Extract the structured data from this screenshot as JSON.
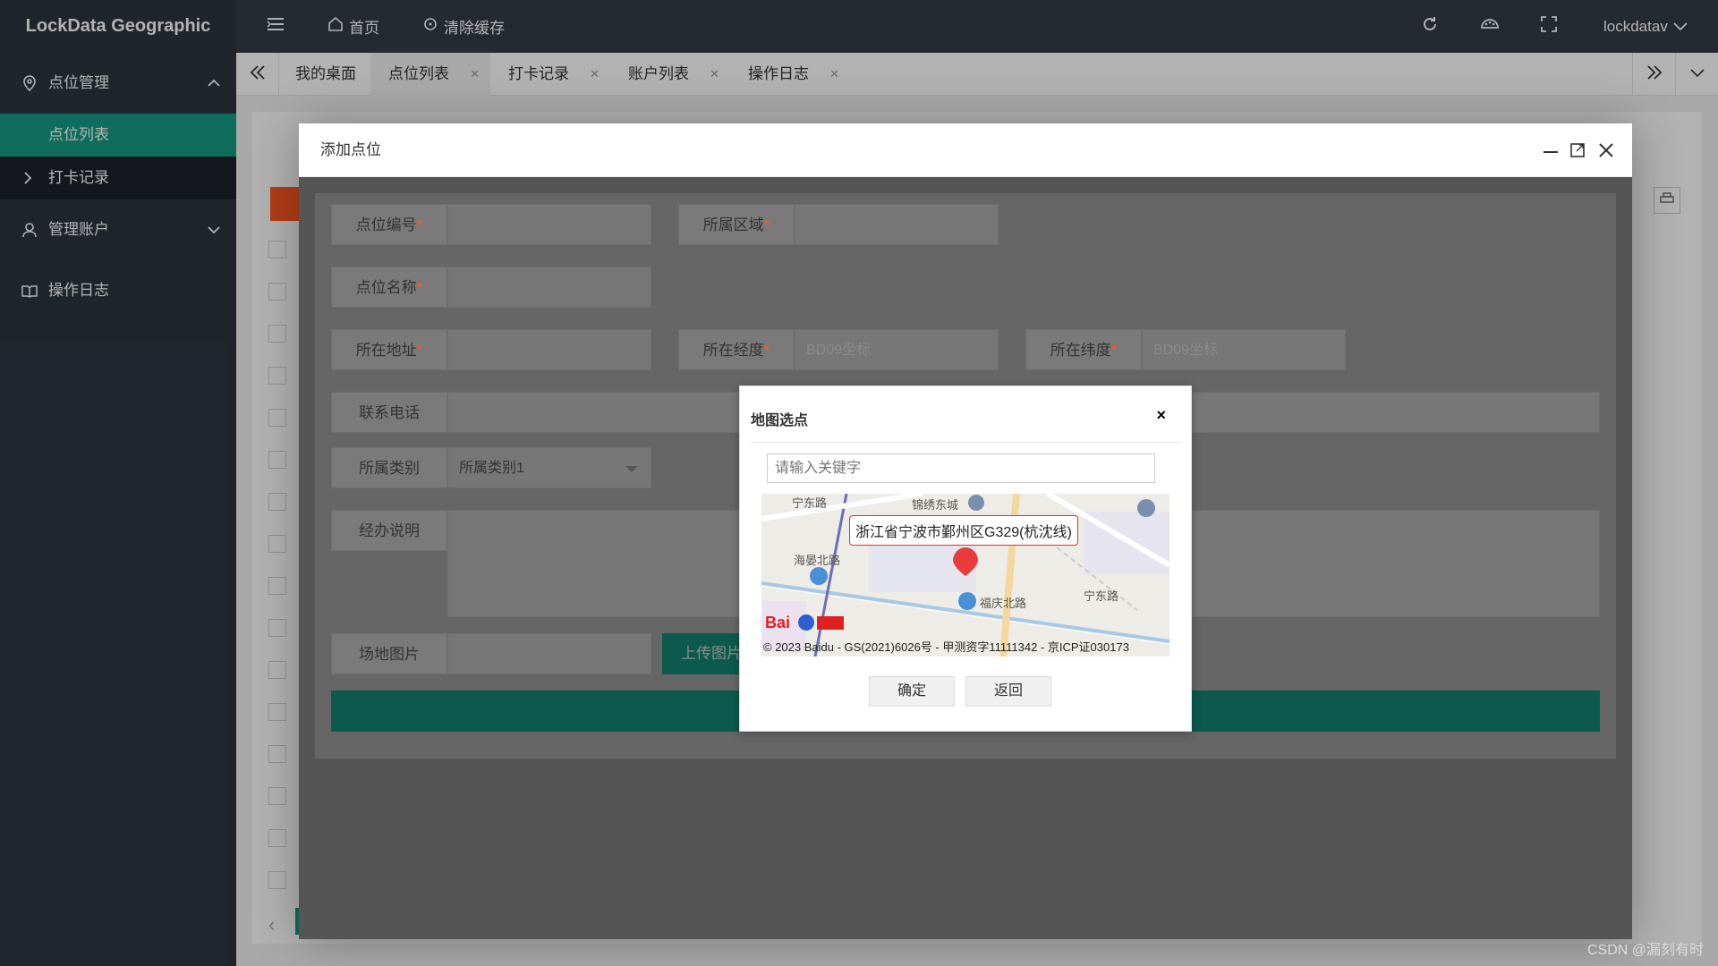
{
  "app": {
    "title": "LockData Geographic"
  },
  "sidebar": {
    "groups": [
      {
        "label": "点位管理",
        "expanded": true,
        "children": [
          {
            "label": "点位列表",
            "active": true
          },
          {
            "label": "打卡记录"
          }
        ]
      },
      {
        "label": "管理账户",
        "expanded": false
      },
      {
        "label": "操作日志"
      }
    ]
  },
  "header": {
    "home_label": "首页",
    "clear_cache_label": "清除缓存",
    "user_label": "lockdatav"
  },
  "tabs": [
    {
      "label": "我的桌面"
    },
    {
      "label": "点位列表",
      "active": true
    },
    {
      "label": "打卡记录"
    },
    {
      "label": "账户列表"
    },
    {
      "label": "操作日志"
    }
  ],
  "layer": {
    "title": "添加点位",
    "fields": {
      "code_label": "点位编号",
      "region_label": "所属区域",
      "name_label": "点位名称",
      "address_label": "所在地址",
      "lng_label": "所在经度",
      "lng_placeholder": "BD09坐标",
      "lat_label": "所在纬度",
      "lat_placeholder": "BD09坐标",
      "phone_label": "联系电话",
      "category_label": "所属类别",
      "category_value": "所属类别1",
      "desc_label": "经办说明",
      "image_label": "场地图片",
      "upload_label": "上传图片"
    },
    "required_mark": "*"
  },
  "map_dialog": {
    "title": "地图选点",
    "close": "×",
    "search_placeholder": "请输入关键字",
    "address_label": "浙江省宁波市鄞州区G329(杭沈线)",
    "streets": [
      "宁东路",
      "锦绣东城",
      "海晏北路",
      "福庆北路",
      "宁东路"
    ],
    "copyright": "© 2023 Baidu - GS(2021)6026号 - 甲测资字11111342 - 京ICP证030173",
    "confirm_label": "确定",
    "back_label": "返回"
  },
  "watermark": "CSDN @漏刻有时",
  "colors": {
    "accent": "#169c87",
    "sidebar": "#2f3540",
    "header": "#353b46",
    "danger": "#ff5722"
  }
}
